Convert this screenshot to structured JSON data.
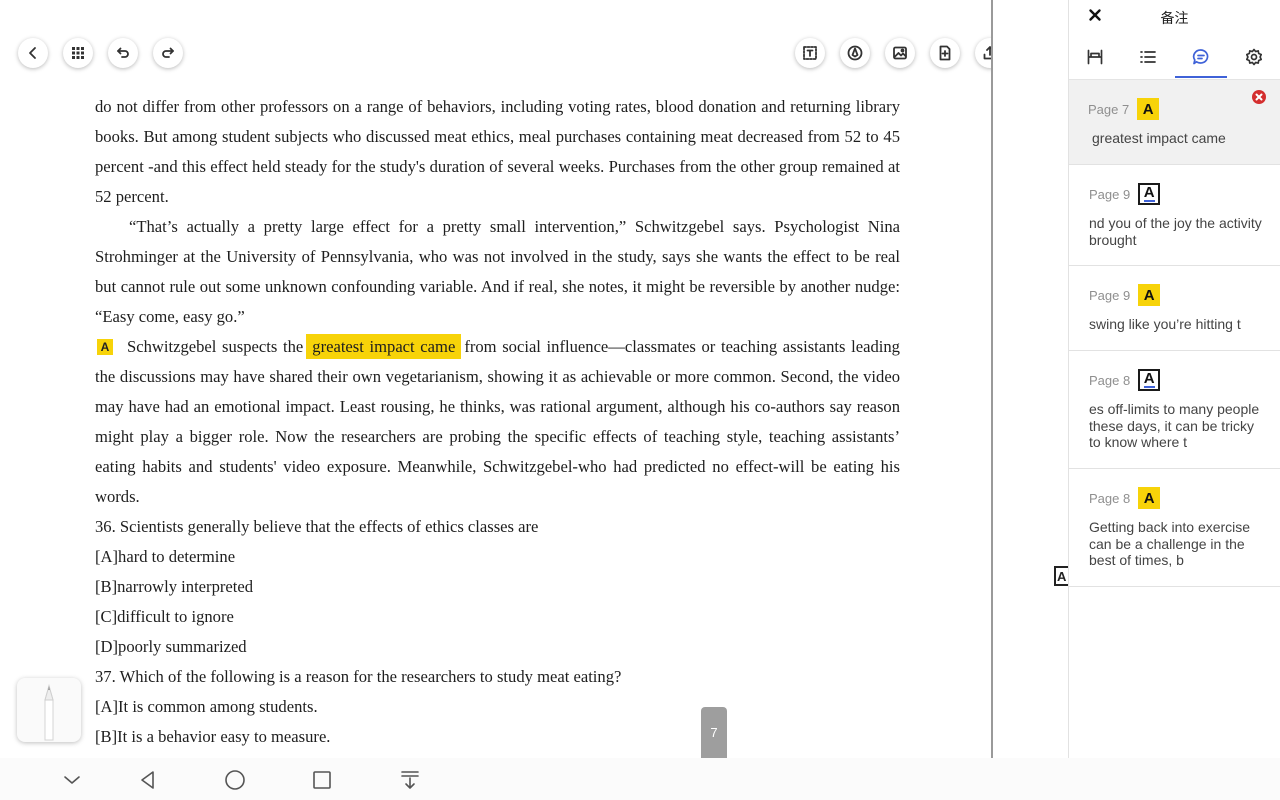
{
  "document": {
    "paragraphs": [
      "do not differ from other professors on a range of behaviors, including voting rates, blood donation and returning library books. But among student subjects who discussed meat ethics, meal purchases containing meat decreased from 52 to 45 percent -and this effect held steady for the study's duration of several weeks. Purchases from the other group remained at 52 percent.",
      "“That’s actually a pretty large effect for a pretty small intervention,” Schwitzgebel says. Psychologist Nina Strohminger at the University of Pennsylvania, who was not involved in the study, says she wants the effect to be real but cannot rule out some unknown confounding variable. And if real, she notes, it might be reversible by another nudge: “Easy come, easy go.”"
    ],
    "highlight_paragraph": {
      "marker": "A",
      "before": "Schwitzgebel suspects the",
      "highlight": "greatest impact came",
      "after": "from social influence—classmates or teaching assistants leading the discussions may have shared their own vegetarianism, showing it as achievable or more common. Second, the video may have had an emotional impact. Least rousing, he thinks, was rational argument, although his co-authors say reason might play a bigger role. Now the researchers are probing the specific effects  of teaching style, teaching assistants’ eating habits and students' video exposure. Meanwhile, Schwitzgebel-who had predicted no effect-will be eating his words."
    },
    "questions": [
      "36. Scientists generally believe that the effects of ethics classes are",
      "[A]hard to determine",
      "[B]narrowly interpreted",
      "[C]difficult to ignore",
      "[D]poorly summarized",
      "37. Which of the following is a reason for the researchers to study meat eating?",
      "[A]It is common among students.",
      "[B]It is a behavior easy to measure."
    ],
    "current_page": "7",
    "edge_marker": "A"
  },
  "toolbar": {
    "left": [
      "back-icon",
      "grid-icon",
      "undo-icon",
      "redo-icon"
    ],
    "right": [
      "text-select-icon",
      "pen-icon",
      "image-icon",
      "add-page-icon",
      "export-icon",
      "layout-icon"
    ]
  },
  "panel": {
    "title": "备注",
    "tabs": [
      "bookmark-icon",
      "list-icon",
      "comment-icon",
      "settings-icon"
    ],
    "active_tab": "comment-icon",
    "notes": [
      {
        "page": "Page 7",
        "badge": "A",
        "style": "filled",
        "text": "greatest impact came",
        "selected": true
      },
      {
        "page": "Page 9",
        "badge": "A",
        "style": "outline",
        "text": "nd you of the joy the activity brought",
        "selected": false
      },
      {
        "page": "Page 9",
        "badge": "A",
        "style": "filled",
        "text": "swing like you’re hitting t",
        "selected": false
      },
      {
        "page": "Page 8",
        "badge": "A",
        "style": "outline",
        "text": "es off-limits to many people these days, it can be tricky to know where t",
        "selected": false
      },
      {
        "page": "Page 8",
        "badge": "A",
        "style": "filled",
        "text": "Getting back into exercise can be a challenge in the best of times, b",
        "selected": false
      }
    ]
  },
  "colors": {
    "highlight": "#f7d309",
    "accent": "#3f62d8",
    "delete": "#d42e2e"
  }
}
